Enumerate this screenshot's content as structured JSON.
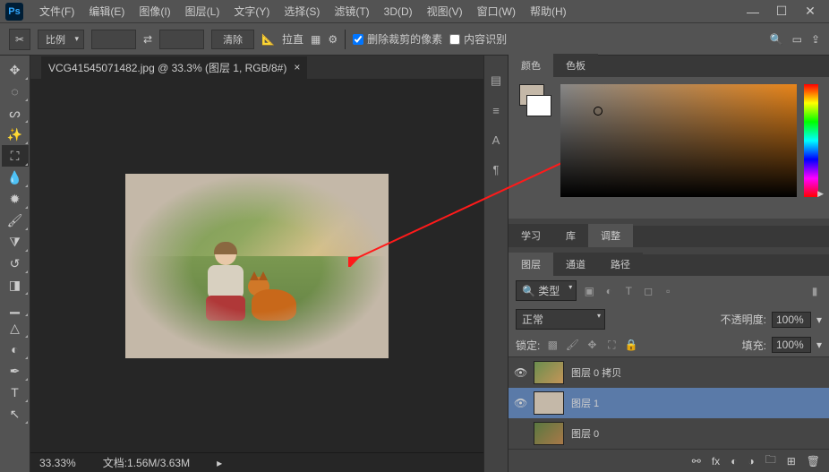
{
  "menu": [
    "文件(F)",
    "编辑(E)",
    "图像(I)",
    "图层(L)",
    "文字(Y)",
    "选择(S)",
    "滤镜(T)",
    "3D(D)",
    "视图(V)",
    "窗口(W)",
    "帮助(H)"
  ],
  "optbar": {
    "ratio_label": "比例",
    "clear": "清除",
    "straighten": "拉直",
    "delete_crop": "删除裁剪的像素",
    "content_aware": "内容识别"
  },
  "doc": {
    "tab": "VCG41545071482.jpg @ 33.3% (图层 1, RGB/8#)",
    "close": "×",
    "zoom": "33.33%",
    "docinfo": "文档:1.56M/3.63M"
  },
  "panel_tabs": {
    "color": "颜色",
    "swatches": "色板",
    "learn": "学习",
    "lib": "库",
    "adjust": "调整",
    "layers": "图层",
    "channels": "通道",
    "paths": "路径"
  },
  "layer_opts": {
    "kind_prefix": "🔍 类型",
    "blend": "正常",
    "opacity_label": "不透明度:",
    "opacity_val": "100%",
    "lock_label": "锁定:",
    "fill_label": "填充:",
    "fill_val": "100%"
  },
  "layers": [
    {
      "name": "图层 0 拷贝",
      "eye": "👁"
    },
    {
      "name": "图层 1",
      "eye": "👁"
    },
    {
      "name": "图层 0",
      "eye": ""
    }
  ]
}
